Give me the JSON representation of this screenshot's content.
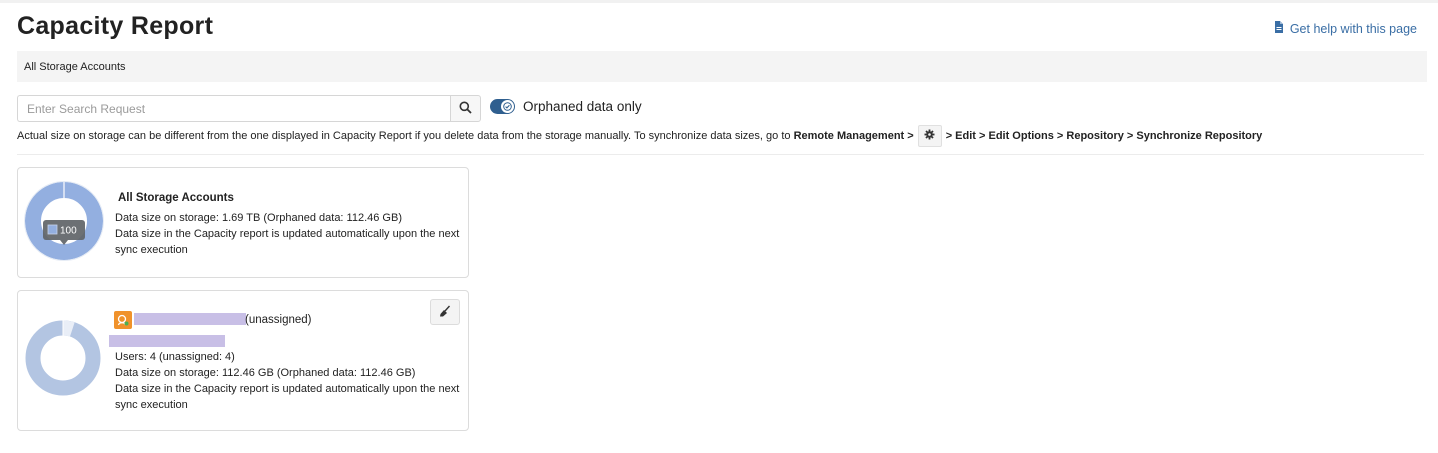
{
  "page": {
    "title": "Capacity Report",
    "help_link": "Get help with this page"
  },
  "breadcrumb": {
    "label": "All Storage Accounts"
  },
  "search": {
    "placeholder": "Enter Search Request"
  },
  "filter": {
    "orphaned_label": "Orphaned data only",
    "orphaned_enabled": true
  },
  "info": {
    "text": "Actual size on storage can be different from the one displayed in Capacity Report if you delete data from the storage manually. To synchronize data sizes, go to",
    "link_remote": "Remote Management >",
    "link_path": "> Edit > Edit Options > Repository > Synchronize Repository"
  },
  "cards": [
    {
      "title": "All Storage Accounts",
      "data_size": "Data size on storage: 1.69 TB (Orphaned data: 112.46 GB)",
      "note": "Data size in the Capacity report is updated automatically upon the next sync execution",
      "tooltip_value": "100",
      "donut_fill_percent": 100,
      "donut_color": "#93afe0"
    },
    {
      "owner_suffix": "(unassigned)",
      "users": "Users: 4 (unassigned: 4)",
      "data_size": "Data size on storage: 112.46 GB (Orphaned data: 112.46 GB)",
      "note": "Data size in the Capacity report is updated automatically upon the next sync execution",
      "donut_fill_percent": 95,
      "donut_color": "#b3c5e2"
    }
  ],
  "icons": {
    "help": "document-icon",
    "search": "search-icon",
    "toggle": "check-icon",
    "gear": "gear-icon",
    "owner": "storage-account-icon",
    "broom": "broom-icon"
  }
}
